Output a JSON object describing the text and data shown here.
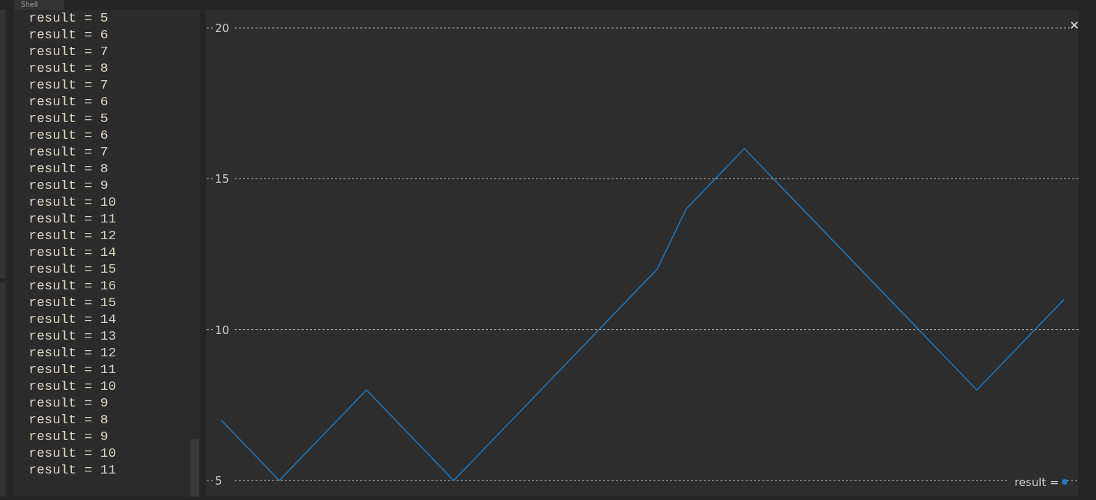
{
  "tab": {
    "label": "Shell"
  },
  "output_lines": [
    "result = 5",
    "result = 6",
    "result = 7",
    "result = 8",
    "result = 7",
    "result = 6",
    "result = 5",
    "result = 6",
    "result = 7",
    "result = 8",
    "result = 9",
    "result = 10",
    "result = 11",
    "result = 12",
    "result = 14",
    "result = 15",
    "result = 16",
    "result = 15",
    "result = 14",
    "result = 13",
    "result = 12",
    "result = 11",
    "result = 10",
    "result = 9",
    "result = 8",
    "result = 9",
    "result = 10",
    "result = 11"
  ],
  "plotter": {
    "chart_data": {
      "type": "line",
      "ylim": [
        5,
        20
      ],
      "yticks": [
        5,
        10,
        15,
        20
      ],
      "grid": true,
      "series": [
        {
          "name": "result =",
          "color": "#1f7ac4",
          "values": [
            7,
            6,
            5,
            6,
            7,
            8,
            7,
            6,
            5,
            6,
            7,
            8,
            9,
            10,
            11,
            12,
            14,
            15,
            16,
            15,
            14,
            13,
            12,
            11,
            10,
            9,
            8,
            9,
            10,
            11
          ]
        }
      ]
    }
  }
}
